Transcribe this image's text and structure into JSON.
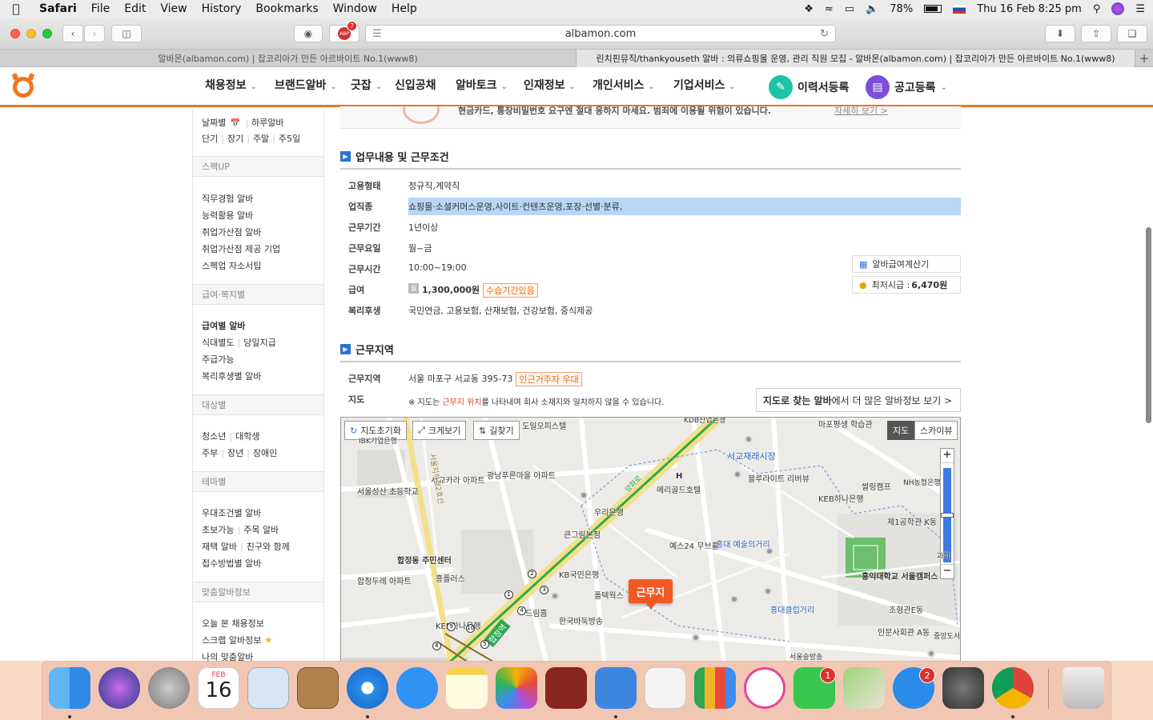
{
  "menubar": {
    "app": "Safari",
    "items": [
      "File",
      "Edit",
      "View",
      "History",
      "Bookmarks",
      "Window",
      "Help"
    ],
    "battery": "78%",
    "datetime": "Thu 16 Feb  8:25 pm"
  },
  "toolbar": {
    "url": "albamon.com",
    "abp_badge": "7",
    "abp_label": "ABP"
  },
  "tabs": [
    {
      "title": "알바몬(albamon.com) | 잡코리아가 만든 아르바이트 No.1(www8)"
    },
    {
      "title": "린치핀뮤직/thankyouseth 알바 : 의류쇼핑몰 운영, 관리 직원 모집 - 알바몬(albamon.com) | 잡코리아가 만든 아르바이트 No.1(www8)"
    }
  ],
  "nav": {
    "items": [
      "채용정보",
      "브랜드알바",
      "긋잡",
      "신입공채",
      "알바토크",
      "인재정보",
      "개인서비스",
      "기업서비스"
    ],
    "resume": "이력서등록",
    "post": "공고등록"
  },
  "sidebar": {
    "top1": [
      "날짜별",
      "하루알바"
    ],
    "top2": [
      "단기",
      "장기",
      "주말",
      "주5일"
    ],
    "h1": "스펙UP",
    "spec": [
      "직무경험 알바",
      "능력활용 알바",
      "취업가산점 알바",
      "취업가산점 제공 기업",
      "스펙업 자소서팁"
    ],
    "h2": "급여·복지별",
    "pay1": "급여별 알바",
    "pay2": [
      "식대별도",
      "당일지급"
    ],
    "pay3": "주급가능",
    "pay4": "복리후생별 알바",
    "h3": "대상별",
    "tg1": [
      "청소년",
      "대학생"
    ],
    "tg2": [
      "주부",
      "장년",
      "장애인"
    ],
    "h4": "테마별",
    "th1": "우대조건별 알바",
    "th2": [
      "초보가능",
      "주목 알바"
    ],
    "th3": [
      "재택 알바",
      "친구와 함께"
    ],
    "th4": "접수방법별 알바",
    "h5": "맞춤알바정보",
    "my1": "오늘 본 채용정보",
    "my2": "스크랩 알바정보",
    "my3": "나의 맞춤알바"
  },
  "banner_text": "현금카드, 통장비밀번호 요구엔 절대 응하지 마세요. 범죄에 이용될 위험이 있습니다.",
  "banner_link": "자세히 보기 >",
  "work": {
    "title": "업무내용 및 근무조건",
    "rows": [
      {
        "label": "고용형태",
        "value": "정규직,계약직"
      },
      {
        "label": "업직종",
        "value": "쇼핑몰·소셜커머스운영,사이트·컨텐츠운영,포장·선별·분류,"
      },
      {
        "label": "근무기간",
        "value": "1년이상"
      },
      {
        "label": "근무요일",
        "value": "월~금"
      },
      {
        "label": "근무시간",
        "value": "10:00~19:00"
      },
      {
        "label": "급여",
        "value": "1,300,000원",
        "badge": "수습기간있음",
        "icon": "월"
      },
      {
        "label": "복리후생",
        "value": "국민연금, 고용보험, 산재보험, 건강보험, 중식제공"
      }
    ],
    "calc": "알바급여계산기",
    "minwage_label": "최저시급 :",
    "minwage_value": "6,470원"
  },
  "area": {
    "title": "근무지역",
    "label_area": "근무지역",
    "address": "서울 마포구 서교동 395-73",
    "address_badge": "인근거주자 우대",
    "label_map": "지도",
    "note_pre": "※ 지도는 ",
    "note_red": "근무지 위치",
    "note_post": "를 나타내며 회사 소재지와 일치하지 않을 수 있습니다.",
    "mapjob_bold": "지도로 찾는 알바",
    "mapjob_rest": "에서 더 많은 알바정보 보기 >"
  },
  "map": {
    "btn_reset": "지도초기화",
    "btn_zoom": "크게보기",
    "btn_route": "길찾기",
    "type_map": "지도",
    "type_sky": "스카이뷰",
    "marker": "근무지",
    "labels": {
      "l1": "서교재래시장",
      "l2": "블루라이트 리버뷰",
      "l3": "메리골드호텔",
      "l4": "KEB하나은행",
      "l5": "썰링캠프",
      "l6": "NH농협은행",
      "l7": "서교카라 아파트",
      "l8": "광남푸른마을 아파트",
      "l9": "우리은행",
      "l10": "큰그림본점",
      "l11": "서울성산 초등학교",
      "l12": "합정동 주민센터",
      "l13": "합정두레 아파트",
      "l14": "흥플러스",
      "l15": "KB국민은행",
      "l16": "폴텍웍스",
      "l17": "예스24 무브홀",
      "l18": "홍대 예술의거리",
      "l19": "홍익대학교 서울캠퍼스",
      "l20": "제1공학관 K동",
      "l21": "홍대클럽거리",
      "l22": "조형관E동",
      "l23": "인문사회관 A동",
      "l24": "중앙도서관 아파트",
      "l25": "드림홈",
      "l26": "한국바둑방송",
      "l27": "KEB하나은행",
      "l28": "합정역",
      "l29": "마포평생 학습관",
      "l30": "KDB산업은행",
      "l31": "IBK기업은행",
      "l32": "서울숭방송",
      "l33": "과학",
      "l34": "서울지하철2호선",
      "l35": "양화로",
      "l36": "도일오피스텔",
      "l37": "H"
    },
    "zoom_plus": "+",
    "zoom_minus": "−"
  },
  "dock": {
    "calendar_month": "FEB",
    "calendar_day": "16",
    "facetime_badge": "1",
    "appstore_badge": "2"
  }
}
